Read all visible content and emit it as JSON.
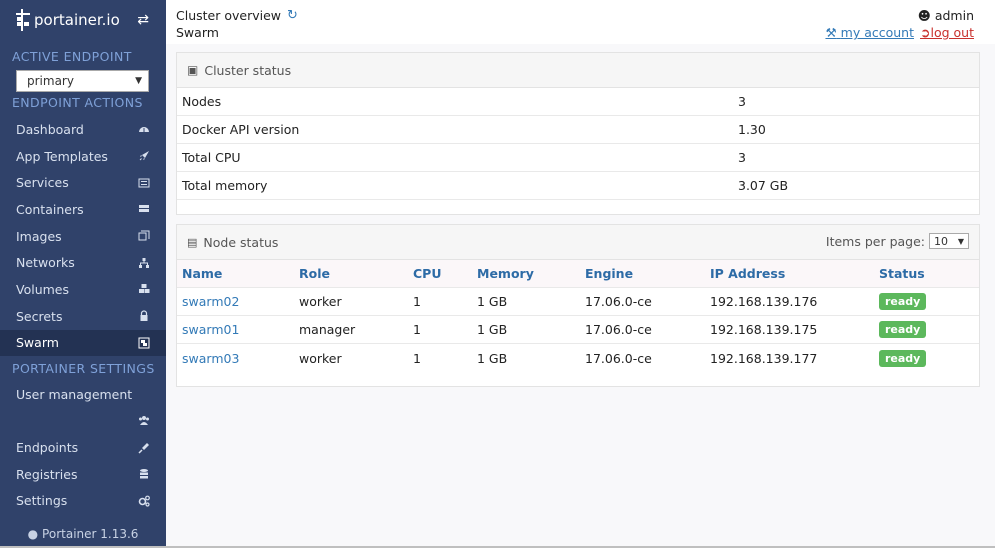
{
  "brand": {
    "name": "portainer.io"
  },
  "sidebar": {
    "active_endpoint_title": "ACTIVE ENDPOINT",
    "endpoint_select": "primary",
    "endpoint_actions_title": "ENDPOINT ACTIONS",
    "items": [
      {
        "label": "Dashboard",
        "icon": "dashboard-icon"
      },
      {
        "label": "App Templates",
        "icon": "rocket-icon"
      },
      {
        "label": "Services",
        "icon": "list-icon"
      },
      {
        "label": "Containers",
        "icon": "server-icon"
      },
      {
        "label": "Images",
        "icon": "clone-icon"
      },
      {
        "label": "Networks",
        "icon": "sitemap-icon"
      },
      {
        "label": "Volumes",
        "icon": "cubes-icon"
      },
      {
        "label": "Secrets",
        "icon": "lock-icon"
      },
      {
        "label": "Swarm",
        "icon": "object-group-icon"
      }
    ],
    "settings_title": "PORTAINER SETTINGS",
    "settings_items": [
      {
        "label": "User management",
        "icon": "users-icon"
      },
      {
        "label": "Endpoints",
        "icon": "plug-icon"
      },
      {
        "label": "Registries",
        "icon": "database-icon"
      },
      {
        "label": "Settings",
        "icon": "cogs-icon"
      }
    ],
    "footer": "Portainer 1.13.6"
  },
  "header": {
    "title": "Cluster overview",
    "subtitle": "Swarm",
    "user": "admin",
    "my_account": "my account",
    "log_out": "log out"
  },
  "cluster_status": {
    "title": "Cluster status",
    "rows": [
      {
        "key": "Nodes",
        "value": "3"
      },
      {
        "key": "Docker API version",
        "value": "1.30"
      },
      {
        "key": "Total CPU",
        "value": "3"
      },
      {
        "key": "Total memory",
        "value": "3.07 GB"
      }
    ]
  },
  "node_status": {
    "title": "Node status",
    "items_per_page_label": "Items per page:",
    "items_per_page": "10",
    "columns": [
      "Name",
      "Role",
      "CPU",
      "Memory",
      "Engine",
      "IP Address",
      "Status"
    ],
    "rows": [
      {
        "name": "swarm02",
        "role": "worker",
        "cpu": "1",
        "memory": "1 GB",
        "engine": "17.06.0-ce",
        "ip": "192.168.139.176",
        "status": "ready"
      },
      {
        "name": "swarm01",
        "role": "manager",
        "cpu": "1",
        "memory": "1 GB",
        "engine": "17.06.0-ce",
        "ip": "192.168.139.175",
        "status": "ready"
      },
      {
        "name": "swarm03",
        "role": "worker",
        "cpu": "1",
        "memory": "1 GB",
        "engine": "17.06.0-ce",
        "ip": "192.168.139.177",
        "status": "ready"
      }
    ]
  },
  "colors": {
    "sidebar": "#30426a",
    "section_title": "#7fa1d8",
    "link": "#337ab7",
    "ready": "#5cb85c",
    "logout": "#c9302c"
  }
}
